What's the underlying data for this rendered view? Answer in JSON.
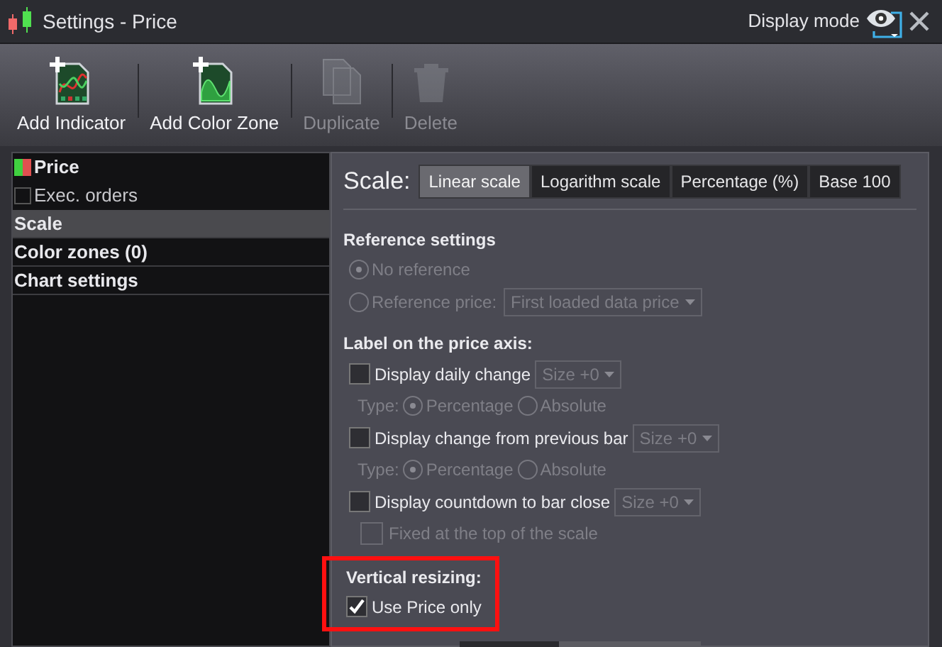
{
  "window": {
    "title": "Settings - Price",
    "display_mode": "Display mode"
  },
  "toolbar": [
    {
      "label": "Add Indicator",
      "kind": "indicator",
      "disabled": false
    },
    {
      "label": "Add Color Zone",
      "kind": "zone",
      "disabled": false
    },
    {
      "label": "Duplicate",
      "kind": "duplicate",
      "disabled": true
    },
    {
      "label": "Delete",
      "kind": "delete",
      "disabled": true
    }
  ],
  "sidebar": [
    {
      "label": "Price",
      "kind": "swatch",
      "selected": false
    },
    {
      "label": "Exec. orders",
      "kind": "checkbox",
      "checked": false,
      "selected": false
    },
    {
      "label": "Scale",
      "kind": "plain",
      "selected": true
    },
    {
      "label": "Color zones (0)",
      "kind": "plain",
      "selected": false
    },
    {
      "label": "Chart settings",
      "kind": "plain",
      "selected": false
    }
  ],
  "scale": {
    "label": "Scale:",
    "tabs": [
      {
        "label": "Linear scale",
        "selected": true
      },
      {
        "label": "Logarithm scale",
        "selected": false
      },
      {
        "label": "Percentage (%)",
        "selected": false
      },
      {
        "label": "Base 100",
        "selected": false
      }
    ]
  },
  "reference": {
    "heading": "Reference settings",
    "disabled": true,
    "options": [
      {
        "label": "No reference",
        "selected": true
      },
      {
        "label": "Reference price:",
        "selected": false,
        "dropdown": "First loaded data price"
      }
    ]
  },
  "price_axis": {
    "heading": "Label on the price axis:",
    "options": [
      {
        "label": "Display daily change",
        "checked": false,
        "dropdown": "Size +0",
        "type_label": "Type:",
        "types": [
          {
            "label": "Percentage",
            "selected": true
          },
          {
            "label": "Absolute",
            "selected": false
          }
        ]
      },
      {
        "label": "Display change from previous bar",
        "checked": false,
        "dropdown": "Size +0",
        "type_label": "Type:",
        "types": [
          {
            "label": "Percentage",
            "selected": true
          },
          {
            "label": "Absolute",
            "selected": false
          }
        ]
      },
      {
        "label": "Display countdown to bar close",
        "checked": false,
        "dropdown": "Size +0",
        "sub": {
          "label": "Fixed at the top of the scale",
          "checked": false,
          "disabled": true
        }
      }
    ]
  },
  "vertical": {
    "heading": "Vertical resizing:",
    "highlighted": true,
    "option": {
      "label": "Use Price only",
      "checked": true
    }
  }
}
